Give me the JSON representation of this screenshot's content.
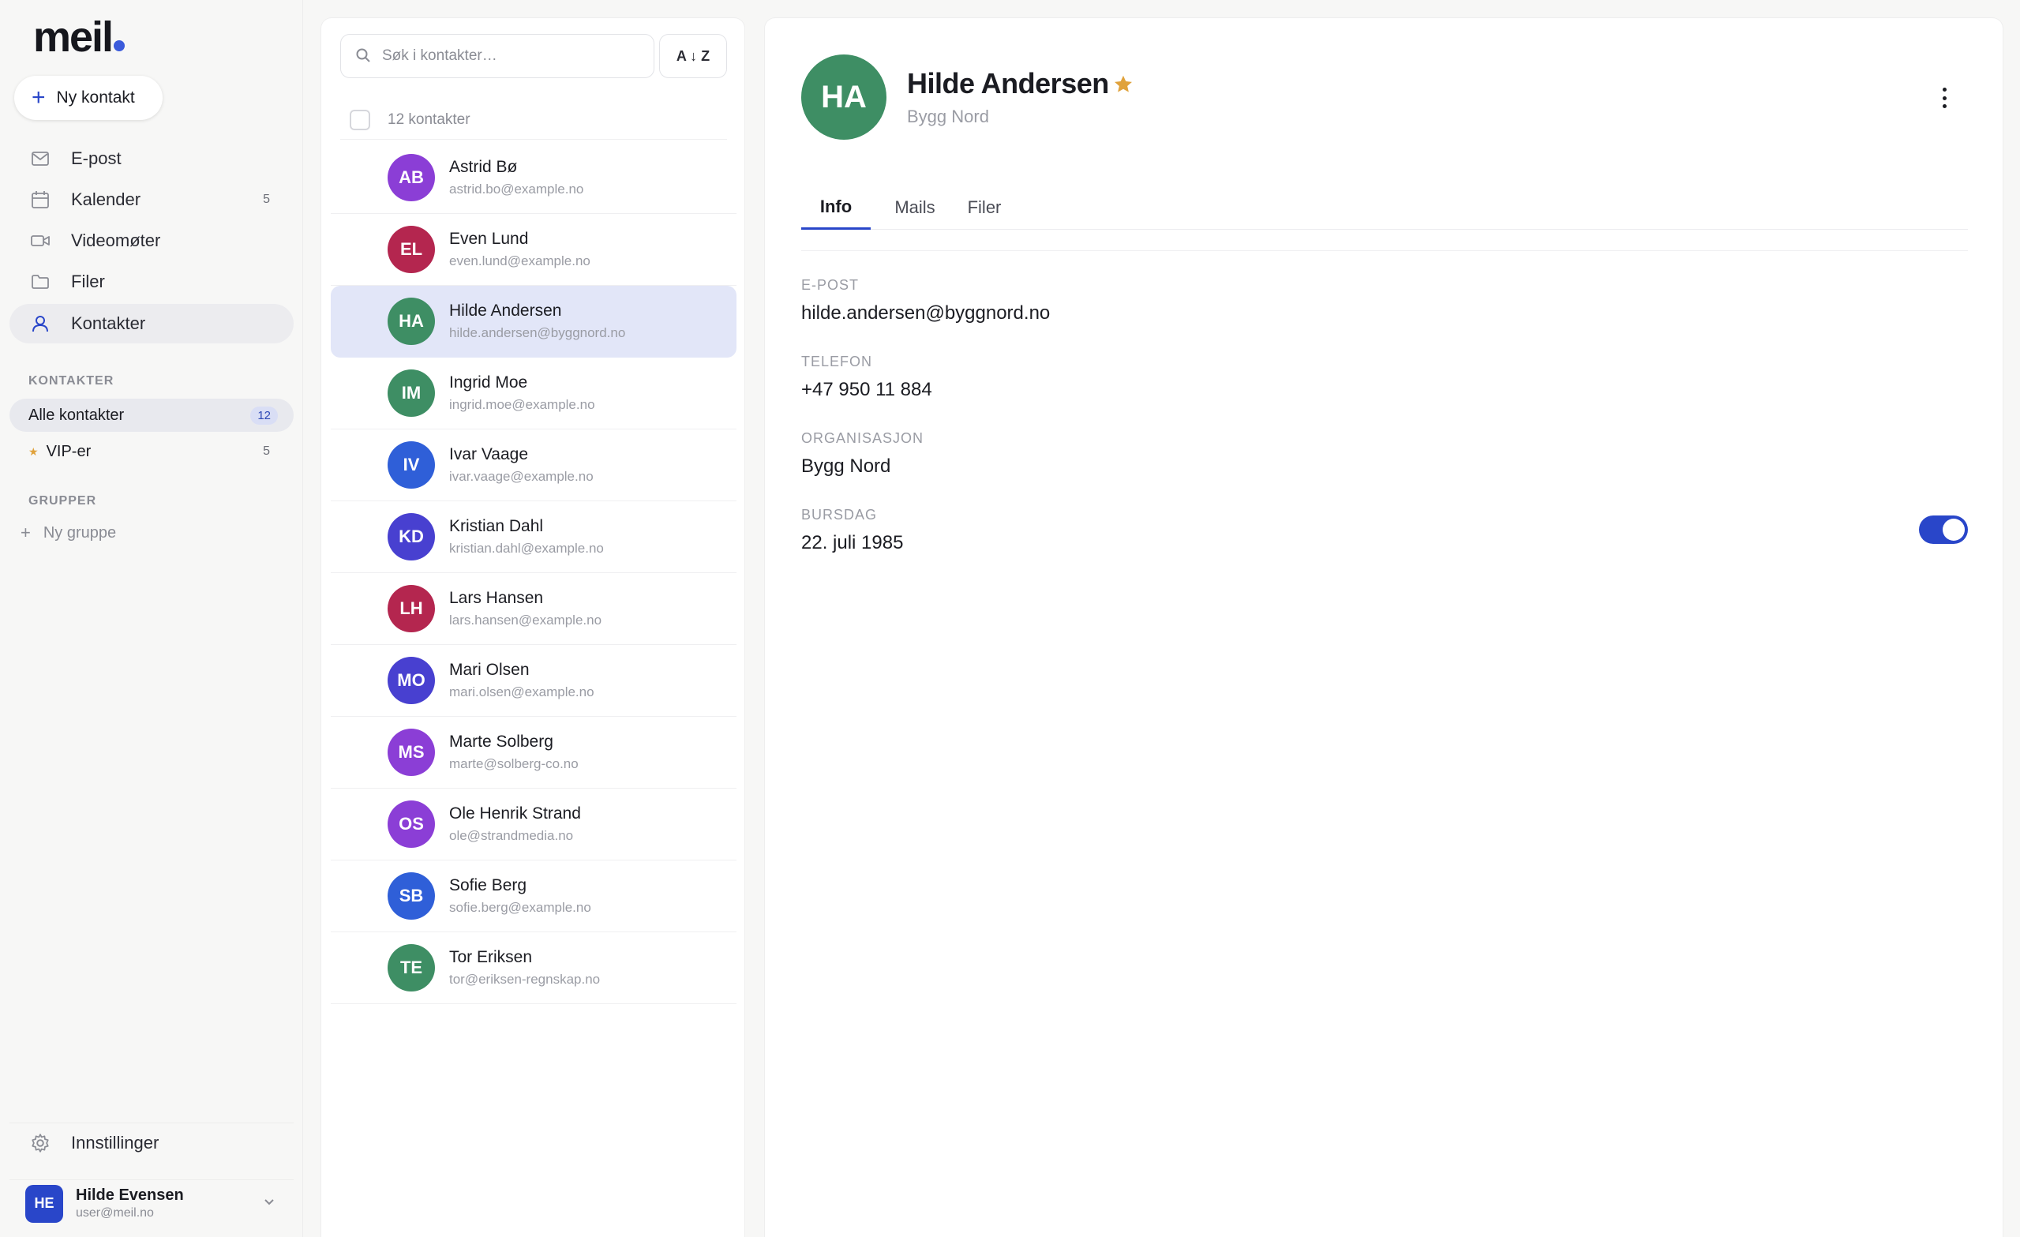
{
  "app": {
    "logo": "meil"
  },
  "sidebar": {
    "new_contact_label": "Ny kontakt",
    "nav": [
      {
        "label": "E-post",
        "icon": "mail-icon",
        "count": ""
      },
      {
        "label": "Kalender",
        "icon": "calendar-icon",
        "count": "5"
      },
      {
        "label": "Videomøter",
        "icon": "video-icon",
        "count": ""
      },
      {
        "label": "Filer",
        "icon": "folder-icon",
        "count": ""
      },
      {
        "label": "Kontakter",
        "icon": "person-icon",
        "count": ""
      }
    ],
    "contacts_section_label": "KONTAKTER",
    "filters": [
      {
        "label": "Alle kontakter",
        "count": "12"
      },
      {
        "label": "VIP-er",
        "count": "5"
      }
    ],
    "groups_section_label": "GRUPPER",
    "new_group_label": "Ny gruppe",
    "settings_label": "Innstillinger",
    "user": {
      "initials": "HE",
      "name": "Hilde Evensen",
      "email": "user@meil.no"
    }
  },
  "list": {
    "search_placeholder": "Søk i kontakter…",
    "sort_label": "A ↓ Z",
    "count_label": "12 kontakter",
    "contacts": [
      {
        "initials": "AB",
        "name": "Astrid Bø",
        "email": "astrid.bo@example.no",
        "color": "#8b3ed6"
      },
      {
        "initials": "EL",
        "name": "Even Lund",
        "email": "even.lund@example.no",
        "color": "#b4264f"
      },
      {
        "initials": "HA",
        "name": "Hilde Andersen",
        "email": "hilde.andersen@byggnord.no",
        "color": "#3e8e64"
      },
      {
        "initials": "IM",
        "name": "Ingrid Moe",
        "email": "ingrid.moe@example.no",
        "color": "#3e8e64"
      },
      {
        "initials": "IV",
        "name": "Ivar Vaage",
        "email": "ivar.vaage@example.no",
        "color": "#2f5fd8"
      },
      {
        "initials": "KD",
        "name": "Kristian Dahl",
        "email": "kristian.dahl@example.no",
        "color": "#4840d0"
      },
      {
        "initials": "LH",
        "name": "Lars Hansen",
        "email": "lars.hansen@example.no",
        "color": "#b4264f"
      },
      {
        "initials": "MO",
        "name": "Mari Olsen",
        "email": "mari.olsen@example.no",
        "color": "#4840d0"
      },
      {
        "initials": "MS",
        "name": "Marte Solberg",
        "email": "marte@solberg-co.no",
        "color": "#8b3ed6"
      },
      {
        "initials": "OS",
        "name": "Ole Henrik Strand",
        "email": "ole@strandmedia.no",
        "color": "#8b3ed6"
      },
      {
        "initials": "SB",
        "name": "Sofie Berg",
        "email": "sofie.berg@example.no",
        "color": "#2f5fd8"
      },
      {
        "initials": "TE",
        "name": "Tor Eriksen",
        "email": "tor@eriksen-regnskap.no",
        "color": "#3e8e64"
      }
    ],
    "selected_index": 2
  },
  "detail": {
    "initials": "HA",
    "avatar_color": "#3e8e64",
    "name": "Hilde Andersen",
    "organization": "Bygg Nord",
    "tabs": [
      "Info",
      "Mails",
      "Filer"
    ],
    "active_tab": 0,
    "fields": {
      "email_label": "E-POST",
      "email_value": "hilde.andersen@byggnord.no",
      "phone_label": "TELEFON",
      "phone_value": "+47 950 11 884",
      "org_label": "ORGANISASJON",
      "org_value": "Bygg Nord",
      "birthday_label": "BURSDAG",
      "birthday_value": "22. juli 1985"
    },
    "birthday_toggle_on": true
  },
  "colors": {
    "accent": "#2946c9",
    "star": "#e0a23b",
    "selected_row": "#e2e6f8"
  }
}
